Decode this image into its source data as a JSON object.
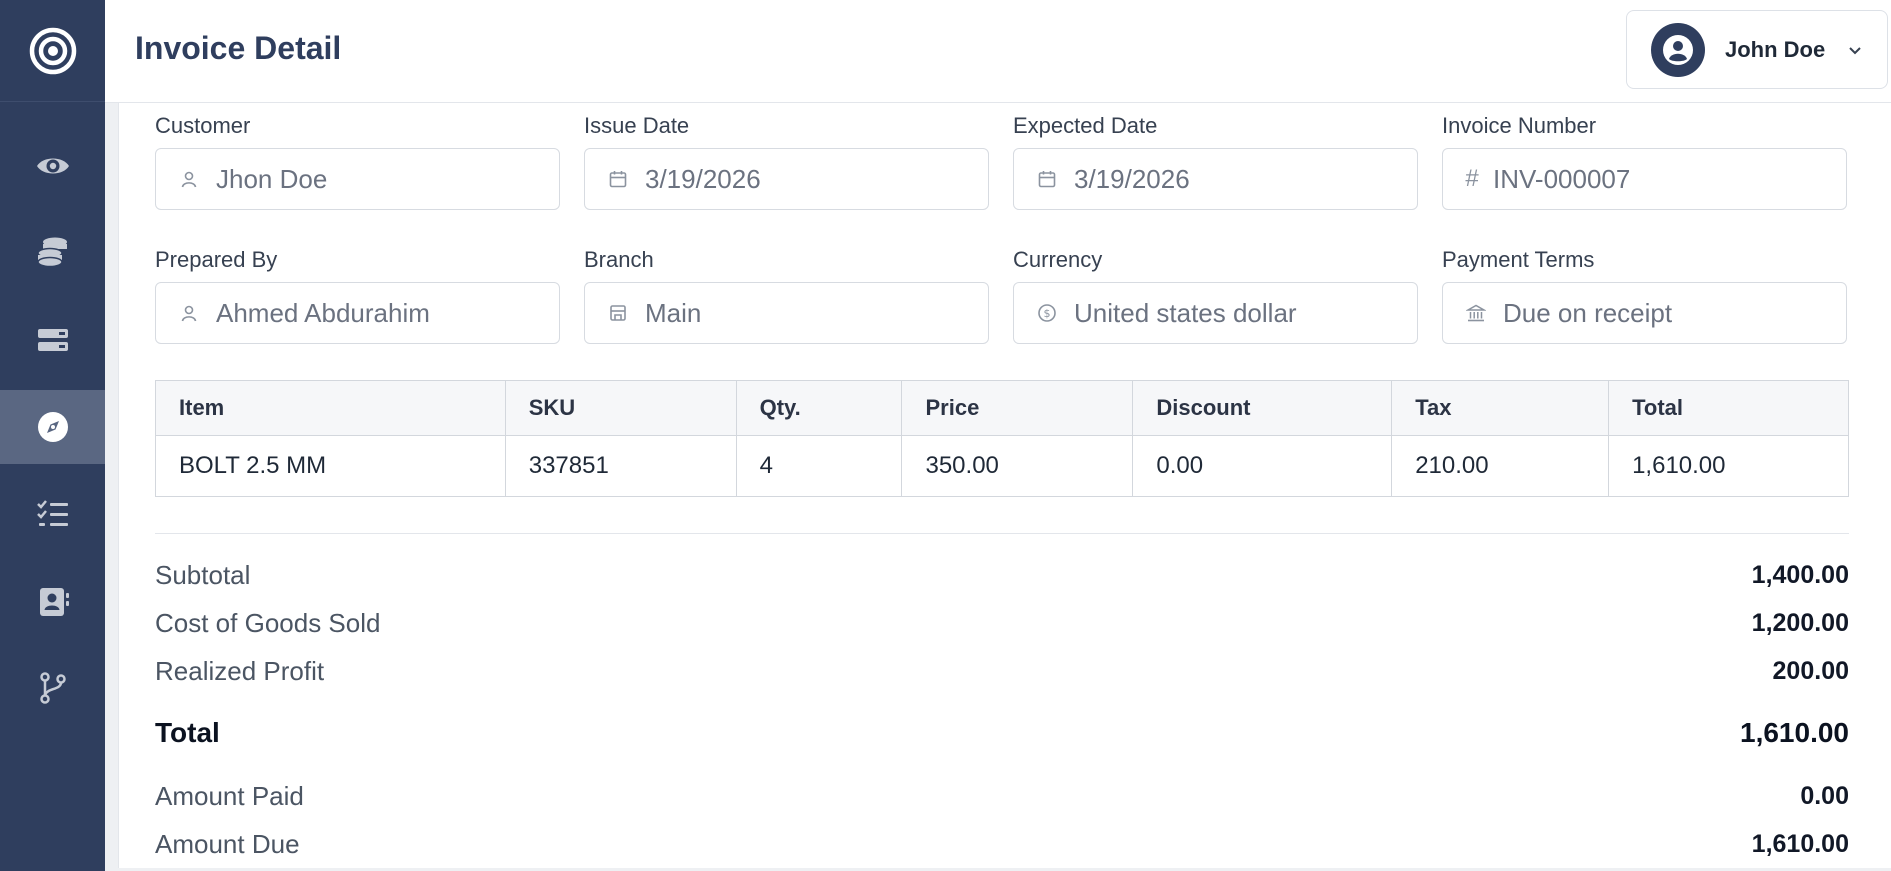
{
  "header": {
    "title": "Invoice Detail",
    "user_name": "John Doe"
  },
  "sidebar": {
    "items": [
      {
        "icon": "eye-icon"
      },
      {
        "icon": "coins-icon"
      },
      {
        "icon": "server-icon"
      },
      {
        "icon": "compass-icon",
        "active": true
      },
      {
        "icon": "checklist-icon"
      },
      {
        "icon": "contact-book-icon"
      },
      {
        "icon": "git-branch-icon"
      }
    ]
  },
  "fields": {
    "customer": {
      "label": "Customer",
      "value": "Jhon Doe",
      "icon": "user-icon"
    },
    "issue_date": {
      "label": "Issue Date",
      "value": "3/19/2026",
      "icon": "calendar-icon"
    },
    "expected_date": {
      "label": "Expected Date",
      "value": "3/19/2026",
      "icon": "calendar-icon"
    },
    "invoice_number": {
      "label": "Invoice Number",
      "value": "INV-000007",
      "icon": "hash-icon"
    },
    "prepared_by": {
      "label": "Prepared By",
      "value": "Ahmed Abdurahim",
      "icon": "user-icon"
    },
    "branch": {
      "label": "Branch",
      "value": "Main",
      "icon": "store-icon"
    },
    "currency": {
      "label": "Currency",
      "value": "United states dollar",
      "icon": "dollar-circle-icon"
    },
    "payment_terms": {
      "label": "Payment Terms",
      "value": "Due on receipt",
      "icon": "bank-icon"
    }
  },
  "table": {
    "headers": [
      "Item",
      "SKU",
      "Qty.",
      "Price",
      "Discount",
      "Tax",
      "Total"
    ],
    "rows": [
      [
        "BOLT 2.5 MM",
        "337851",
        "4",
        "350.00",
        "0.00",
        "210.00",
        "1,610.00"
      ]
    ]
  },
  "summary": {
    "subtotal": {
      "label": "Subtotal",
      "value": "1,400.00"
    },
    "cogs": {
      "label": "Cost of Goods Sold",
      "value": "1,200.00"
    },
    "profit": {
      "label": "Realized Profit",
      "value": "200.00"
    },
    "total": {
      "label": "Total",
      "value": "1,610.00"
    },
    "paid": {
      "label": "Amount Paid",
      "value": "0.00"
    },
    "due": {
      "label": "Amount Due",
      "value": "1,610.00"
    }
  },
  "colors": {
    "sidebar_bg": "#2f3e5e",
    "sidebar_active": "#5a6782",
    "title": "#2f3e5e"
  }
}
